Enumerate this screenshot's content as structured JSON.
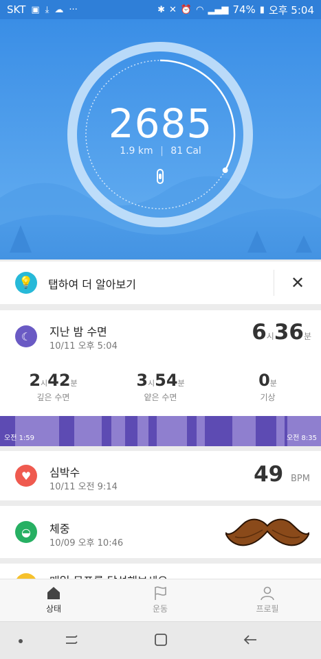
{
  "status_bar": {
    "carrier": "SKT",
    "battery": "74%",
    "time": "오후 5:04"
  },
  "activity": {
    "steps": "2685",
    "distance_value": "1.9",
    "distance_unit": "km",
    "calories_value": "81",
    "calories_unit": "Cal",
    "goal_progress": 0.33
  },
  "tip_card": {
    "text": "탭하여 더 알아보기",
    "close_icon": "close-icon"
  },
  "sleep": {
    "title": "지난 밤 수면",
    "timestamp": "10/11 오후 5:04",
    "total_hours": "6",
    "hour_unit": "시",
    "total_minutes": "36",
    "minute_unit": "분",
    "deep": {
      "h": "2",
      "hu": "시",
      "m": "42",
      "mu": "분",
      "label": "깊은 수면"
    },
    "light": {
      "h": "3",
      "hu": "시",
      "m": "54",
      "mu": "분",
      "label": "얕은 수면"
    },
    "awake": {
      "m": "0",
      "mu": "분",
      "label": "기상"
    },
    "start_time": "오전 1:59",
    "end_time": "오전 8:35",
    "colors": {
      "deep": "#5d4bb3",
      "light": "#8f7fcf"
    }
  },
  "heart_rate": {
    "title": "심박수",
    "timestamp": "10/11 오전 9:14",
    "value": "49",
    "unit": "BPM"
  },
  "weight": {
    "title": "체중",
    "timestamp": "10/09 오후 10:46"
  },
  "goal_peek": {
    "title": "매일 목표를 달성해보세요"
  },
  "tabs": [
    {
      "label": "상태",
      "icon": "home-icon",
      "active": true
    },
    {
      "label": "운동",
      "icon": "flag-icon",
      "active": false
    },
    {
      "label": "프로필",
      "icon": "person-icon",
      "active": false
    }
  ],
  "colors": {
    "accent": "#3a8ee6",
    "sleep": "#6a5ac4",
    "heart": "#ef5a4f",
    "weight": "#27b063",
    "tip": "#27b9d8"
  }
}
